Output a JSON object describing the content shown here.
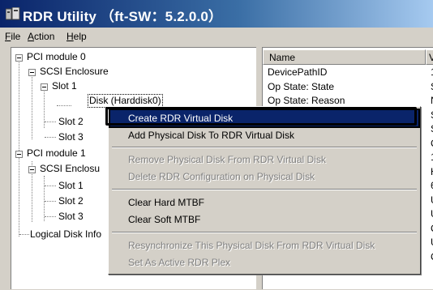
{
  "window": {
    "title": "RDR Utility （ft-SW：5.2.0.0）"
  },
  "menu": [
    {
      "label": "File",
      "accel": "F",
      "rest": "ile"
    },
    {
      "label": "Action",
      "accel": "A",
      "rest": "ction"
    },
    {
      "label": "Help",
      "accel": "H",
      "rest": "elp"
    }
  ],
  "tree": {
    "pci0": "PCI module 0",
    "scsi0": "SCSI Enclosure",
    "slot1": "Slot 1",
    "disk": "Disk (Harddisk0)",
    "slot2": "Slot 2",
    "slot3": "Slot 3",
    "pci1": "PCI module 1",
    "scsi1": "SCSI Enclosu",
    "slot1b": "Slot 1",
    "slot2b": "Slot 2",
    "slot3b": "Slot 3",
    "logical": "Logical Disk Info"
  },
  "list": {
    "col_name": "Name",
    "col_value": "V",
    "rows": [
      {
        "name": "DevicePathID",
        "value": "1"
      },
      {
        "name": "Op State: State",
        "value": "S"
      },
      {
        "name": "Op State: Reason",
        "value": "N"
      },
      {
        "name": "",
        "value": "S"
      },
      {
        "name": "",
        "value": "S"
      },
      {
        "name": "",
        "value": "C"
      },
      {
        "name": "",
        "value": "1"
      },
      {
        "name": "",
        "value": "H"
      },
      {
        "name": "",
        "value": "6"
      },
      {
        "name": "",
        "value": "U"
      },
      {
        "name": "",
        "value": "U"
      },
      {
        "name": "",
        "value": "C"
      },
      {
        "name": "",
        "value": "U"
      },
      {
        "name": "",
        "value": "C"
      }
    ]
  },
  "context_menu": {
    "create_virtual": "Create RDR Virtual Disk",
    "add_physical": "Add Physical Disk To RDR Virtual Disk",
    "remove_physical": "Remove Physical Disk From RDR Virtual Disk",
    "delete_config": "Delete RDR Configuration on Physical Disk",
    "clear_hard": "Clear Hard MTBF",
    "clear_soft": "Clear Soft MTBF",
    "resync": "Resynchronize This Physical Disk From RDR Virtual Disk",
    "set_active": "Set As Active RDR Plex"
  },
  "colors": {
    "selection": "#0a246a",
    "face": "#d4d0c8"
  }
}
